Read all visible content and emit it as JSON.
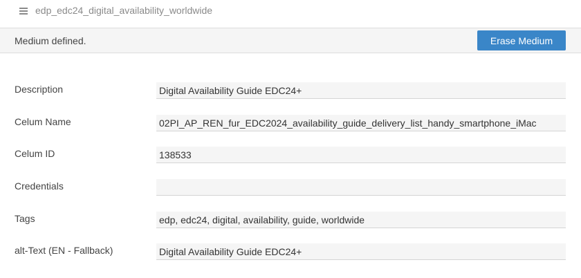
{
  "header": {
    "title": "edp_edc24_digital_availability_worldwide",
    "menu_icon": "hamburger-icon"
  },
  "status": {
    "message": "Medium defined.",
    "erase_label": "Erase Medium"
  },
  "colors": {
    "accent": "#3a86c8",
    "field_background": "#f5f5f5",
    "status_background": "#f5f5f5"
  },
  "fields": [
    {
      "label": "Description",
      "value": "Digital Availability Guide EDC24+"
    },
    {
      "label": "Celum Name",
      "value": "02PI_AP_REN_fur_EDC2024_availability_guide_delivery_list_handy_smartphone_iMac"
    },
    {
      "label": "Celum ID",
      "value": "138533"
    },
    {
      "label": "Credentials",
      "value": ""
    },
    {
      "label": "Tags",
      "value": "edp, edc24, digital, availability, guide, worldwide"
    },
    {
      "label": "alt-Text (EN - Fallback)",
      "value": "Digital Availability Guide EDC24+"
    }
  ]
}
